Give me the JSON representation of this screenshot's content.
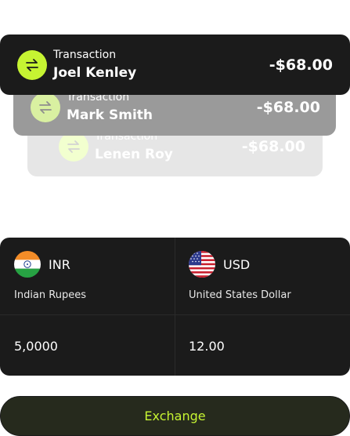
{
  "transactions": [
    {
      "type_label": "Transaction",
      "name": "Joel Kenley",
      "amount": "-$68.00",
      "icon": "swap-arrows-icon"
    },
    {
      "type_label": "Transaction",
      "name": "Mark Smith",
      "amount": "-$68.00",
      "icon": "swap-arrows-icon"
    },
    {
      "type_label": "Transaction",
      "name": "Lenen Roy",
      "amount": "-$68.00",
      "icon": "swap-arrows-icon"
    }
  ],
  "exchange": {
    "from": {
      "code": "INR",
      "name": "Indian Rupees",
      "amount": "5,0000",
      "flag_icon": "india-flag-icon"
    },
    "to": {
      "code": "USD",
      "name": "United States Dollar",
      "amount": "12.00",
      "flag_icon": "usa-flag-icon"
    },
    "button_label": "Exchange"
  },
  "colors": {
    "accent": "#c6f432",
    "card_dark": "#1b1b1b",
    "card_mid": "#9a9a9a",
    "card_light": "#e6e6e6",
    "button_bg": "#262a1d"
  }
}
